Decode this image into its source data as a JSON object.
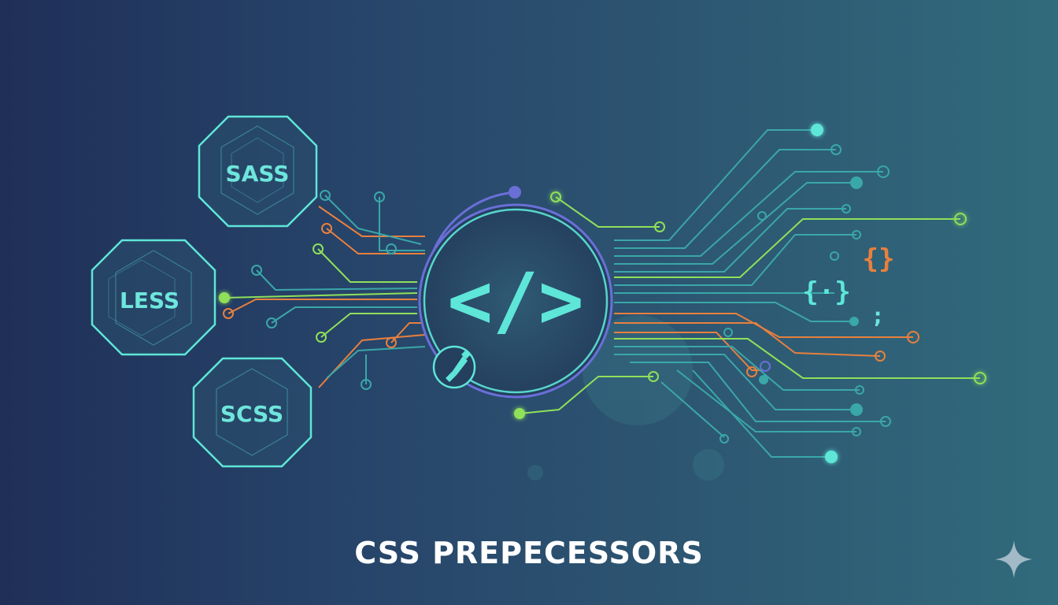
{
  "title": "CSS PREPECESSORS",
  "preprocessors": [
    {
      "label": "SASS",
      "name": "sass"
    },
    {
      "label": "LESS",
      "name": "less"
    },
    {
      "label": "SCSS",
      "name": "scss"
    }
  ],
  "center_symbol": "</>",
  "symbols": {
    "brace_orange": "{}",
    "brace_cyan": "{·}",
    "semicolon": ";"
  },
  "colors": {
    "background_start": "#1f2f58",
    "background_end": "#316b7c",
    "cyan": "#5ee6d8",
    "teal": "#3aa7a8",
    "green": "#8fe05a",
    "orange": "#e8803e",
    "purple": "#6a6fd8",
    "title": "#ffffff"
  },
  "icons": {
    "center": "code-icon",
    "brush": "paintbrush-icon",
    "corner": "sparkle-icon"
  }
}
